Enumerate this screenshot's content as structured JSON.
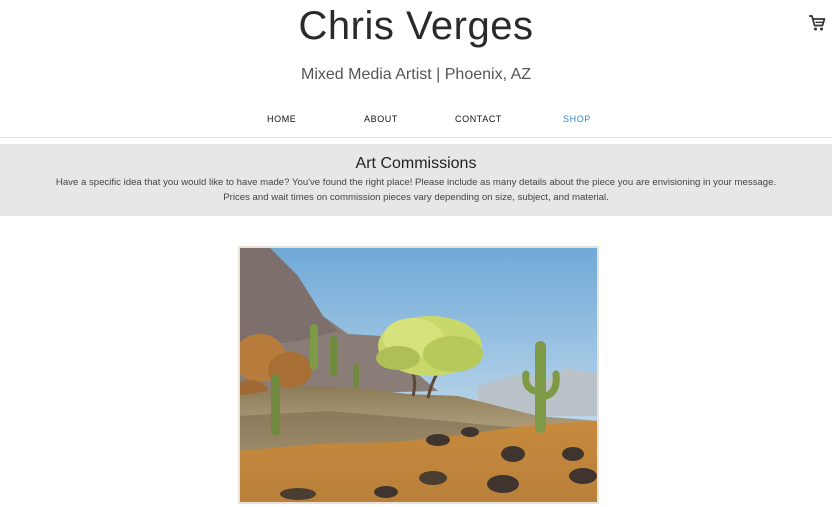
{
  "header": {
    "title": "Chris Verges",
    "tagline": "Mixed Media Artist | Phoenix, AZ",
    "cart_icon": "shopping-cart-icon"
  },
  "nav": {
    "items": [
      {
        "label": "HOME"
      },
      {
        "label": "ABOUT"
      },
      {
        "label": "CONTACT"
      },
      {
        "label": "SHOP"
      }
    ],
    "active": "SHOP",
    "active_color": "#3a86c8"
  },
  "banner": {
    "heading": "Art Commissions",
    "line1": "Have a specific idea that you would like to have made? You've found the right place! Please include as many details about the piece you are envisioning in your message.",
    "line2": "Prices and wait times on commission pieces vary depending on size, subject, and material.",
    "background": "#e7e7e7"
  },
  "artwork": {
    "subject": "watercolor desert landscape with saguaro cacti, mountain and palo verde tree"
  }
}
